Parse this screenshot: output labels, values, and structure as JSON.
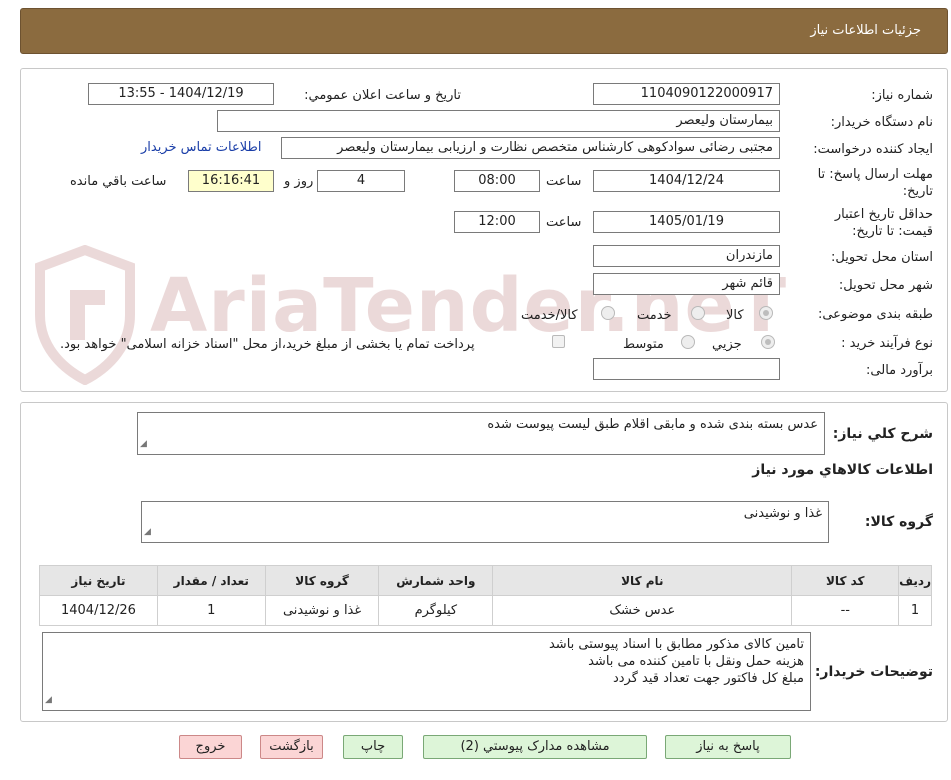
{
  "header": {
    "title": "جزئيات اطلاعات نياز"
  },
  "form": {
    "need_number_label": "شماره نياز:",
    "need_number": "1104090122000917",
    "announce_label": "تاريخ و ساعت اعلان عمومي:",
    "announce_value": "1404/12/19 - 13:55",
    "buyer_org_label": "نام دستگاه خريدار:",
    "buyer_org": "بیمارستان ولیعصر",
    "creator_label": "ايجاد کننده درخواست:",
    "creator": "مجتبی رضائی سوادکوهی کارشناس متخصص نظارت و ارزیابی بیمارستان ولیعصر",
    "contact_link": "اطلاعات تماس خريدار",
    "deadline_label": "مهلت ارسال پاسخ: تا تاريخ:",
    "deadline_date": "1404/12/24",
    "time_word": "ساعت",
    "deadline_time": "08:00",
    "days_value": "4",
    "days_word": "روز و",
    "remaining_time": "16:16:41",
    "remaining_label": "ساعت باقي مانده",
    "validity_label": "حداقل تاريخ اعتبار قيمت: تا تاريخ:",
    "validity_date": "1405/01/19",
    "validity_time": "12:00",
    "province_label": "استان محل تحويل:",
    "province": "مازندران",
    "city_label": "شهر محل تحويل:",
    "city": "قائم شهر",
    "category_label": "طبقه بندی موضوعی:",
    "category_options": [
      "کالا",
      "خدمت",
      "کالا/خدمت"
    ],
    "process_label": "نوع فرآيند خريد :",
    "process_options": [
      "جزيي",
      "متوسط"
    ],
    "payment_note": "پرداخت تمام یا بخشی از مبلغ خرید،از محل \"اسناد خزانه اسلامی\" خواهد بود.",
    "budget_label": "برآورد مالی:",
    "budget_value": ""
  },
  "details": {
    "summary_label": "شرح کلي نياز:",
    "summary": "عدس بسته بندی شده و مابقی اقلام طبق لیست پیوست شده",
    "items_title": "اطلاعات کالاهاي مورد نياز",
    "group_label": "گروه کالا:",
    "group_value": "غذا و نوشيدنی",
    "table": {
      "headers": [
        "رديف",
        "کد کالا",
        "نام کالا",
        "واحد شمارش",
        "گروه کالا",
        "تعداد / مقدار",
        "تاريخ نياز"
      ],
      "rows": [
        [
          "1",
          "--",
          "عدس خشک",
          "کیلوگرم",
          "غذا و نوشيدنی",
          "1",
          "1404/12/26"
        ]
      ]
    },
    "buyer_notes_label": "توضيحات خريدار:",
    "buyer_notes": [
      "تامین کالای مذکور مطابق با اسناد پیوستی باشد",
      "هزینه حمل ونقل با تامین کننده می باشد",
      "مبلغ کل  فاکتور جهت تعداد قید گردد"
    ]
  },
  "buttons": {
    "reply": "پاسخ به نياز",
    "attachments": "مشاهده مدارک پيوستي (2)",
    "print": "چاپ",
    "back": "بازگشت",
    "exit": "خروج"
  },
  "watermark": {
    "text": "AriaTender.neT"
  }
}
